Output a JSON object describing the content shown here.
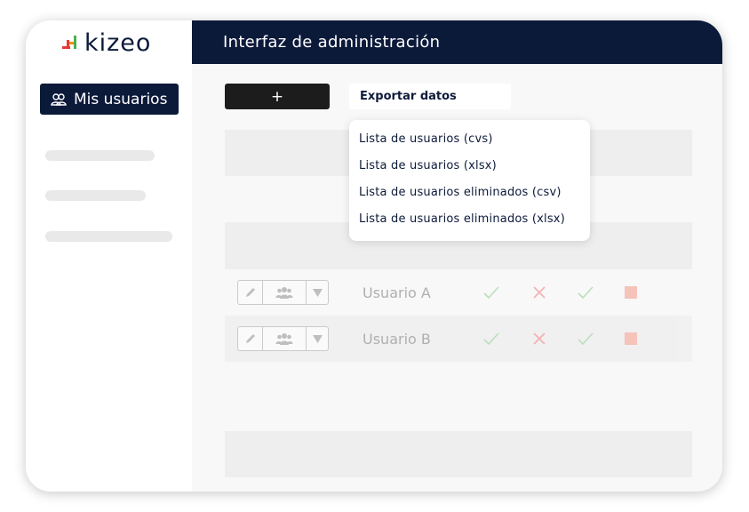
{
  "app": {
    "logo_text": "kizeo",
    "header_title": "Interfaz de administración"
  },
  "sidebar": {
    "active_item_label": "Mis usuarios",
    "active_item_icon": "users-icon"
  },
  "toolbar": {
    "add_label": "+",
    "export_label": "Exportar datos"
  },
  "export_menu": {
    "items": [
      "Lista de usuarios (cvs)",
      "Lista de usuarios (xlsx)",
      "Lista de usuarios eliminados (csv)",
      "Lista de usuarios eliminados (xlsx)"
    ]
  },
  "users": [
    {
      "name": "Usuario A",
      "status": [
        "check",
        "cross",
        "check",
        "square"
      ]
    },
    {
      "name": "Usuario B",
      "status": [
        "check",
        "cross",
        "check",
        "square"
      ]
    }
  ],
  "colors": {
    "navy": "#0c1a3a",
    "check": "#4caf50",
    "cross": "#e53935",
    "square": "#f0624a",
    "logo_orange": "#f39200",
    "logo_red": "#e53935",
    "logo_green": "#4caf50"
  }
}
